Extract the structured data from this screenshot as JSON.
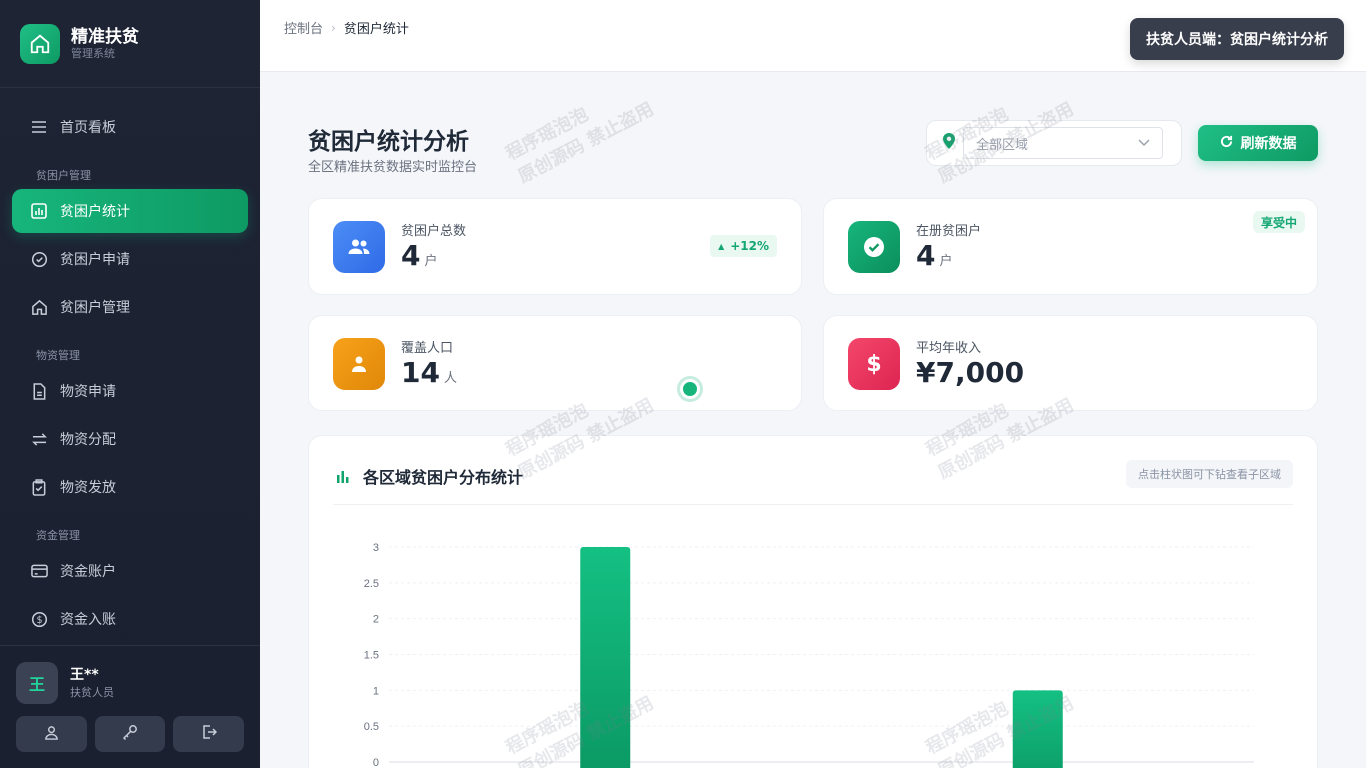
{
  "brand": {
    "title": "精准扶贫",
    "subtitle": "管理系统"
  },
  "sidebar": {
    "top_item": {
      "label": "首页看板",
      "icon": "menu-icon"
    },
    "groups": [
      {
        "title": "贫困户管理",
        "items": [
          {
            "label": "贫困户统计",
            "icon": "bar-chart-icon",
            "active": true
          },
          {
            "label": "贫困户申请",
            "icon": "check-circle-icon"
          },
          {
            "label": "贫困户管理",
            "icon": "home-icon"
          }
        ]
      },
      {
        "title": "物资管理",
        "items": [
          {
            "label": "物资申请",
            "icon": "document-icon"
          },
          {
            "label": "物资分配",
            "icon": "swap-icon"
          },
          {
            "label": "物资发放",
            "icon": "clipboard-check-icon"
          }
        ]
      },
      {
        "title": "资金管理",
        "items": [
          {
            "label": "资金账户",
            "icon": "credit-card-icon"
          },
          {
            "label": "资金入账",
            "icon": "dollar-circle-icon"
          }
        ]
      }
    ]
  },
  "user": {
    "avatar_text": "王",
    "name": "王**",
    "role": "扶贫人员"
  },
  "topbar": {
    "breadcrumb": [
      "控制台",
      "贫困户统计"
    ],
    "tooltip": "扶贫人员端：贫困户统计分析"
  },
  "page": {
    "title": "贫困户统计分析",
    "subtitle": "全区精准扶贫数据实时监控台",
    "region_placeholder": "全部区域",
    "refresh_label": "刷新数据"
  },
  "stats": [
    {
      "label": "贫困户总数",
      "value": "4",
      "unit": "户",
      "trend": "+12%",
      "color": "#3b82f6",
      "icon": "users-icon"
    },
    {
      "label": "在册贫困户",
      "value": "4",
      "unit": "户",
      "tag": "享受中",
      "color": "#10a36b",
      "icon": "check-icon"
    },
    {
      "label": "覆盖人口",
      "value": "14",
      "unit": "人",
      "color": "#f59e0b",
      "icon": "person-icon"
    },
    {
      "label": "平均年收入",
      "value": "¥7,000",
      "unit": "",
      "color": "#ef4460",
      "icon": "dollar-icon"
    }
  ],
  "chart": {
    "title": "各区域贫困户分布统计",
    "hint": "点击柱状图可下钻查看子区域"
  },
  "chart_data": {
    "type": "bar",
    "categories": [
      "",
      ""
    ],
    "values": [
      3,
      1
    ],
    "yticks": [
      "0",
      "0.5",
      "1",
      "1.5",
      "2",
      "2.5",
      "3"
    ],
    "ylim": [
      0,
      3
    ],
    "grid": true,
    "color": "#10b07a"
  },
  "watermark": {
    "line1": "程序瑶泡泡",
    "line2": "原创源码 禁止盗用"
  }
}
